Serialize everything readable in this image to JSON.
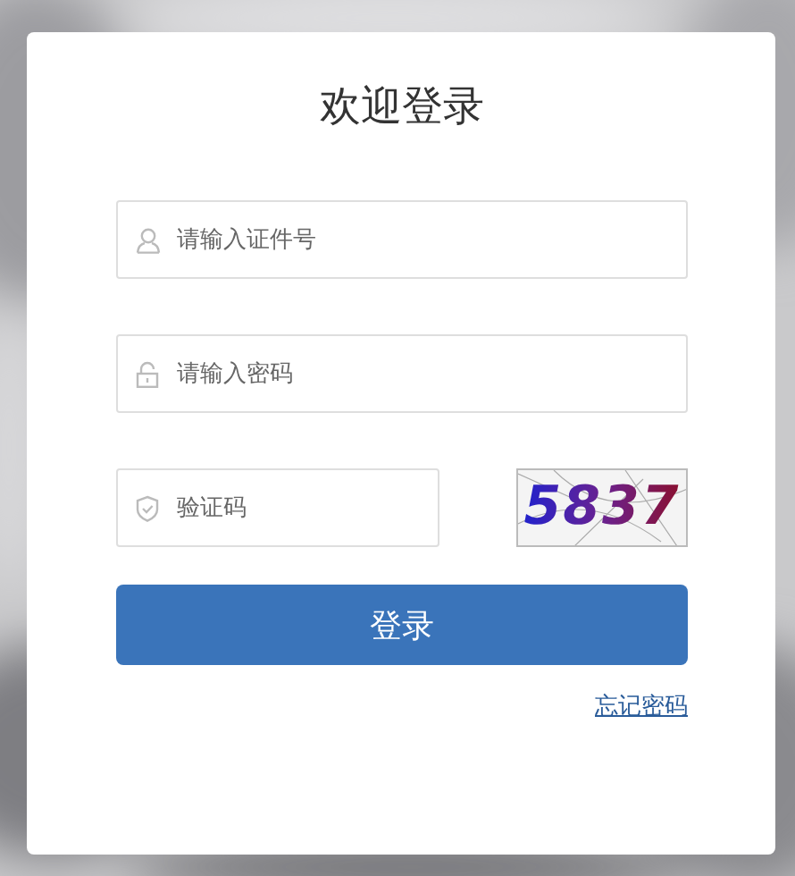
{
  "title": "欢迎登录",
  "fields": [
    {
      "kind": "user",
      "placeholder": "请输入证件号"
    },
    {
      "kind": "password",
      "placeholder": "请输入密码"
    }
  ],
  "captcha": {
    "placeholder": "验证码",
    "code": "5837"
  },
  "login_button": "登录",
  "forgot_link": "忘记密码"
}
